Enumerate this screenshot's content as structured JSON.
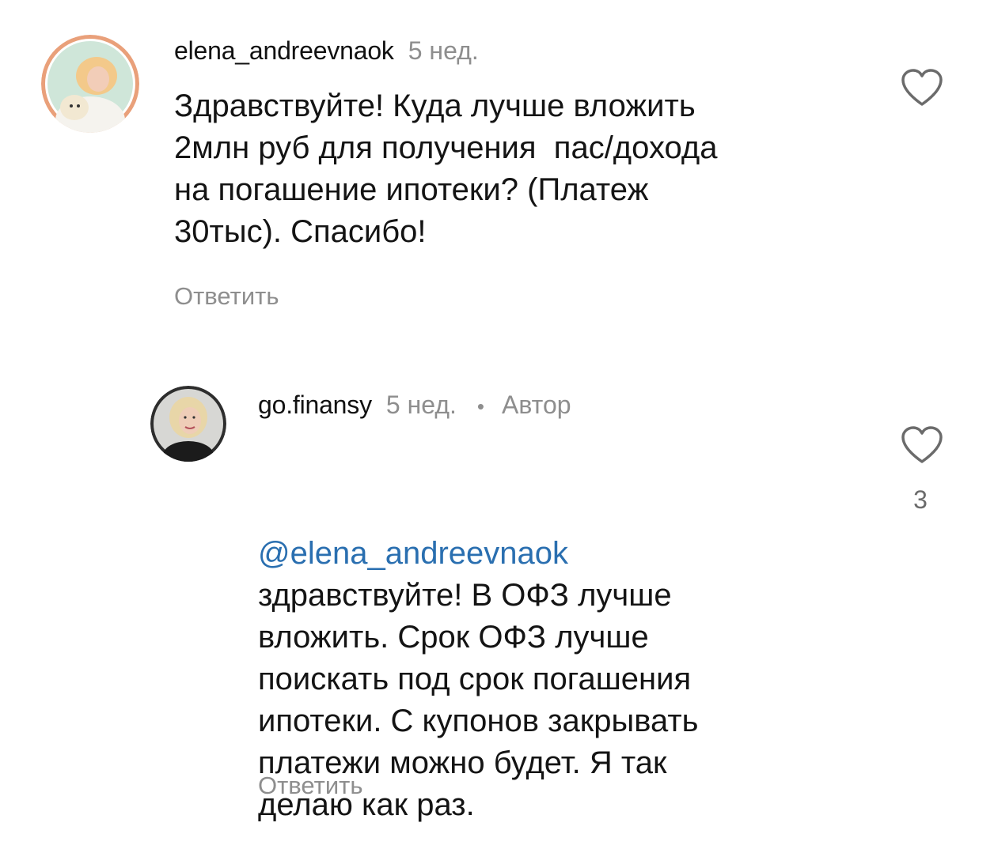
{
  "comments": [
    {
      "username": "elena_andreevnaok",
      "time": "5 нед.",
      "text": "Здравствуйте! Куда лучше вложить\n2млн руб для получения  пас/дохода\nна погашение ипотеки? (Платеж\n30тыс). Спасибо!",
      "reply_label": "Ответить",
      "like_icon": "heart-outline-icon"
    },
    {
      "username": "go.finansy",
      "time": "5 нед.",
      "separator": "•",
      "author_label": "Автор",
      "mention": "@elena_andreevnaok",
      "text": "здравствуйте! В ОФЗ лучше\nвложить. Срок ОФЗ лучше\nпоискать под срок погашения\nипотеки. С купонов закрывать\nплатежи можно будет. Я так\nделаю как раз.",
      "reply_label": "Ответить",
      "like_icon": "heart-outline-icon",
      "like_count": "3"
    }
  ],
  "colors": {
    "text": "#141414",
    "muted": "#8e8e8e",
    "mention": "#2a6fb0",
    "avatar_ring": "#e9a07a"
  }
}
